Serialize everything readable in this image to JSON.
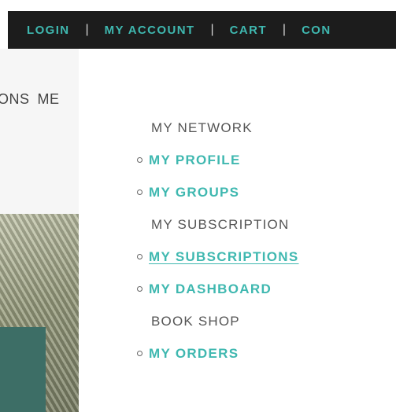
{
  "topbar": {
    "links": [
      "LOGIN",
      "MY ACCOUNT",
      "CART",
      "CON"
    ],
    "separator": "|"
  },
  "left_nav": {
    "items": [
      "ONS",
      "ME"
    ]
  },
  "menu": {
    "entries": [
      {
        "type": "heading",
        "label": "MY NETWORK"
      },
      {
        "type": "link",
        "label": "MY PROFILE"
      },
      {
        "type": "link",
        "label": "MY GROUPS"
      },
      {
        "type": "heading",
        "label": "MY SUBSCRIPTION"
      },
      {
        "type": "link",
        "label": "MY SUBSCRIPTIONS",
        "hovered": true
      },
      {
        "type": "link",
        "label": "MY DASHBOARD"
      },
      {
        "type": "heading",
        "label": "BOOK SHOP"
      },
      {
        "type": "link",
        "label": "MY ORDERS"
      }
    ]
  },
  "colors": {
    "accent": "#3fb8b0",
    "topbar_bg": "#1c1c1c",
    "heading_text": "#555555"
  }
}
